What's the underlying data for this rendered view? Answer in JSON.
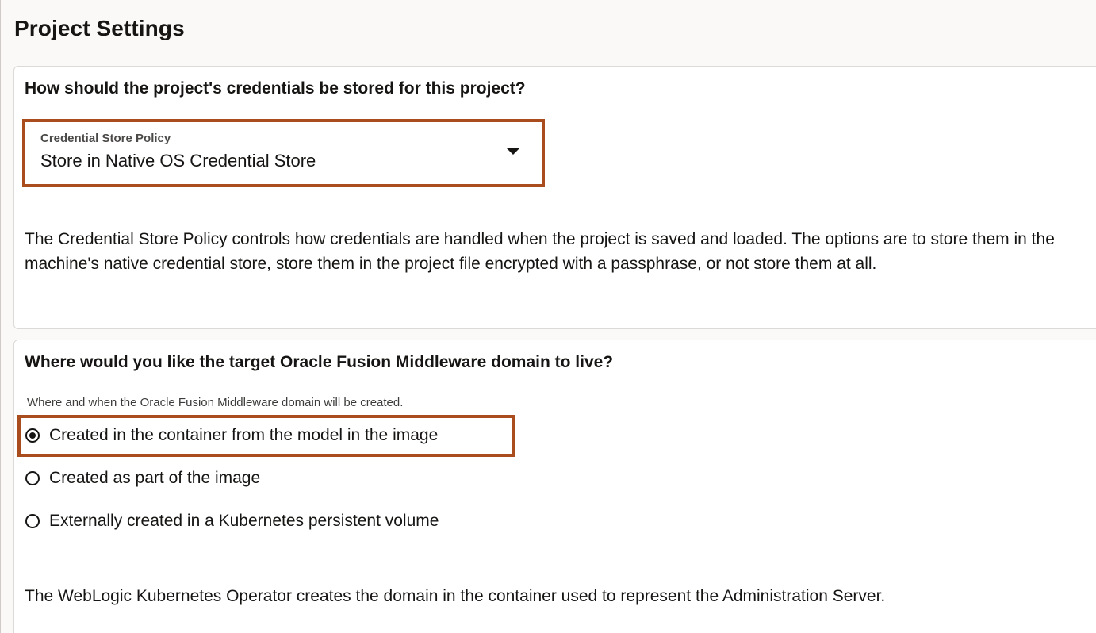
{
  "page": {
    "title": "Project Settings"
  },
  "credentials": {
    "heading": "How should the project's credentials be stored for this project?",
    "select": {
      "label": "Credential Store Policy",
      "value": "Store in Native OS Credential Store"
    },
    "description": "The Credential Store Policy controls how credentials are handled when the project is saved and loaded. The options are to store them in the machine's native credential store, store them in the project file encrypted with a passphrase, or not store them at all."
  },
  "domain": {
    "heading": "Where would you like the target Oracle Fusion Middleware domain to live?",
    "help": "Where and when the Oracle Fusion Middleware domain will be created.",
    "options": [
      {
        "label": "Created in the container from the model in the image",
        "selected": true
      },
      {
        "label": "Created as part of the image",
        "selected": false
      },
      {
        "label": "Externally created in a Kubernetes persistent volume",
        "selected": false
      }
    ],
    "description": "The WebLogic Kubernetes Operator creates the domain in the container used to represent the Administration Server."
  },
  "colors": {
    "highlight": "#a94d1f",
    "text": "#161513",
    "card_border": "#dcdad6"
  },
  "icons": {
    "dropdown": "chevron-down-icon",
    "radio_selected": "radio-selected-icon",
    "radio_unselected": "radio-unselected-icon"
  }
}
